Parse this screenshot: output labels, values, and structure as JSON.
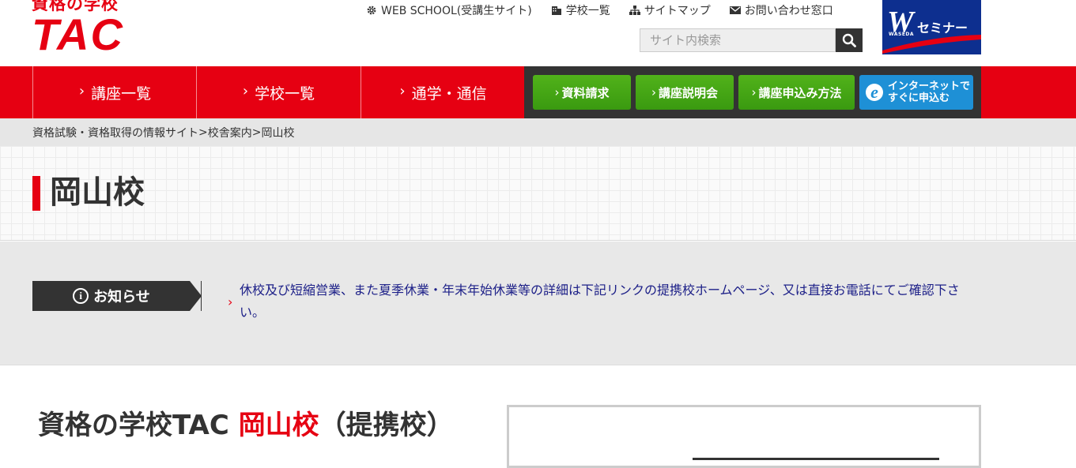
{
  "header": {
    "logo_sub": "資格の学校",
    "logo_main": "TAC",
    "util_links": [
      {
        "label": "WEB SCHOOL(受講生サイト)",
        "icon": "gear-icon"
      },
      {
        "label": "学校一覧",
        "icon": "building-icon"
      },
      {
        "label": "サイトマップ",
        "icon": "sitemap-icon"
      },
      {
        "label": "お問い合わせ窓口",
        "icon": "mail-icon"
      }
    ],
    "search_placeholder": "サイト内検索",
    "wseminar": {
      "letter": "W",
      "text": "セミナー",
      "sub": "WASEDA"
    }
  },
  "nav": {
    "items": [
      "講座一覧",
      "学校一覧",
      "通学・通信"
    ],
    "green_buttons": [
      "資料請求",
      "講座説明会",
      "講座申込み方法"
    ],
    "blue_button": [
      "インターネットで",
      "すぐに申込む"
    ]
  },
  "breadcrumb": [
    "資格試験・資格取得の情報サイト",
    "校舎案内",
    "岡山校"
  ],
  "page_title": "岡山校",
  "notice": {
    "label": "お知らせ",
    "text": "休校及び短縮営業、また夏季休業・年末年始休業等の詳細は下記リンクの提携校ホームページ、又は直接お電話にてご確認下さい。"
  },
  "content": {
    "heading_prefix": "資格の学校TAC ",
    "heading_red": "岡山校",
    "heading_suffix": "（提携校）"
  },
  "colors": {
    "brand_red": "#e60012",
    "nav_dark": "#333333",
    "green": "#4aab16",
    "blue": "#1e90d6",
    "link_navy": "#1d2088"
  }
}
